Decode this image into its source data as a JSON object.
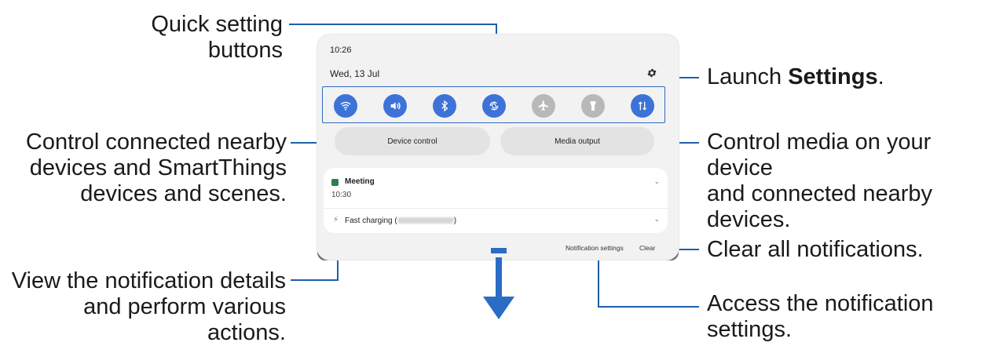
{
  "annotations": {
    "quick_settings": "Quick setting buttons",
    "launch_settings_prefix": "Launch ",
    "launch_settings_bold": "Settings",
    "launch_settings_suffix": ".",
    "control_nearby": [
      "Control connected nearby",
      "devices and SmartThings",
      "devices and scenes."
    ],
    "control_media": [
      "Control media on your device",
      "and connected nearby",
      "devices."
    ],
    "clear_all": "Clear all notifications.",
    "view_details": [
      "View the notification details",
      "and perform various actions."
    ],
    "access_settings": [
      "Access the notification",
      "settings."
    ]
  },
  "panel": {
    "time": "10:26",
    "date": "Wed, 13 Jul",
    "quick_buttons": [
      {
        "icon": "wifi-icon",
        "state": "on"
      },
      {
        "icon": "sound-icon",
        "state": "on"
      },
      {
        "icon": "bluetooth-icon",
        "state": "on"
      },
      {
        "icon": "auto-rotate-icon",
        "state": "on"
      },
      {
        "icon": "airplane-icon",
        "state": "off"
      },
      {
        "icon": "flashlight-icon",
        "state": "off"
      },
      {
        "icon": "mobile-data-icon",
        "state": "on"
      }
    ],
    "device_control": "Device control",
    "media_output": "Media output",
    "meeting_title": "Meeting",
    "meeting_time": "10:30",
    "fast_charging": "Fast charging (",
    "fast_charging_end": ")",
    "notification_settings": "Notification settings",
    "clear": "Clear"
  },
  "colors": {
    "accent": "#3d72d8",
    "callout_line": "#1f5fa8",
    "arrow": "#2b6cc4"
  }
}
